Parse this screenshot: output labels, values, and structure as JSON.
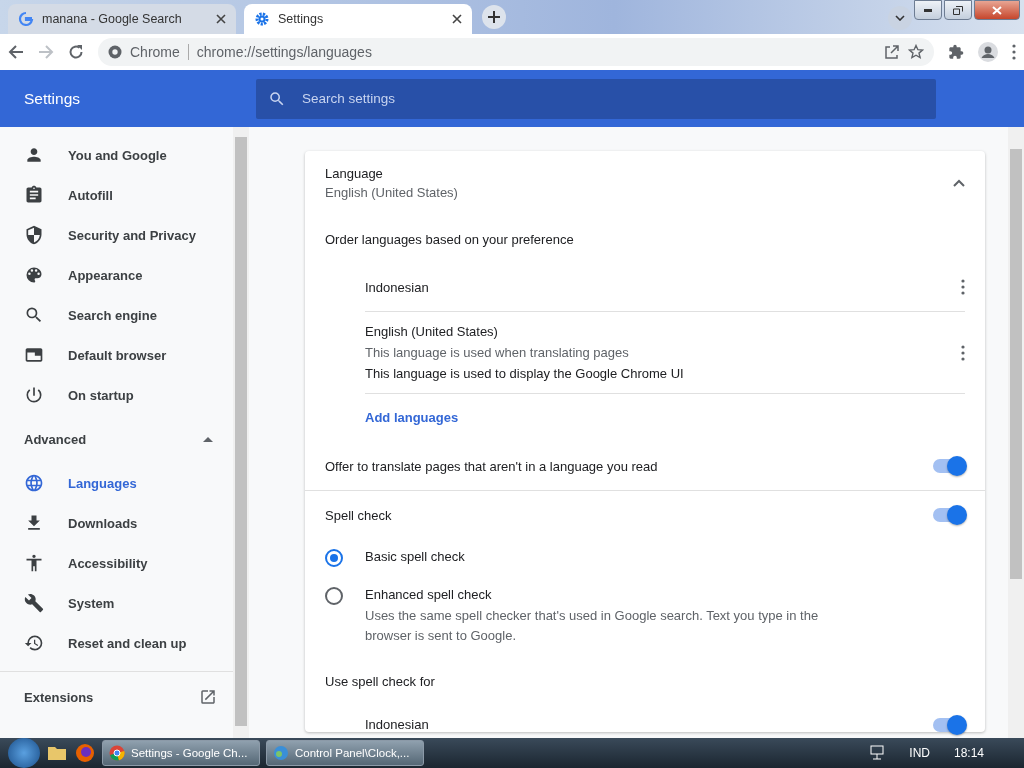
{
  "browser": {
    "tabs": [
      {
        "title": "manana - Google Search",
        "kind": "google",
        "selected": false
      },
      {
        "title": "Settings",
        "kind": "settings",
        "selected": true
      }
    ],
    "address": {
      "site": "Chrome",
      "url": "chrome://settings/languages"
    }
  },
  "header": {
    "title": "Settings",
    "search_placeholder": "Search settings"
  },
  "sidebar": {
    "items": [
      {
        "label": "You and Google",
        "kind": "person",
        "selected": false
      },
      {
        "label": "Autofill",
        "kind": "clipboard",
        "selected": false
      },
      {
        "label": "Security and Privacy",
        "kind": "shield",
        "selected": false
      },
      {
        "label": "Appearance",
        "kind": "palette",
        "selected": false
      },
      {
        "label": "Search engine",
        "kind": "search",
        "selected": false
      },
      {
        "label": "Default browser",
        "kind": "window",
        "selected": false
      },
      {
        "label": "On startup",
        "kind": "power",
        "selected": false
      }
    ],
    "advanced": {
      "label": "Advanced",
      "expanded": true,
      "items": [
        {
          "label": "Languages",
          "kind": "globe",
          "selected": true
        },
        {
          "label": "Downloads",
          "kind": "download",
          "selected": false
        },
        {
          "label": "Accessibility",
          "kind": "accessibility",
          "selected": false
        },
        {
          "label": "System",
          "kind": "wrench",
          "selected": false
        },
        {
          "label": "Reset and clean up",
          "kind": "history",
          "selected": false
        }
      ]
    },
    "extensions": "Extensions"
  },
  "language_card": {
    "language": {
      "label": "Language",
      "value": "English (United States)",
      "expanded": true
    },
    "order_heading": "Order languages based on your preference",
    "languages": [
      {
        "name": "Indonesian"
      },
      {
        "name": "English (United States)",
        "notes": [
          "This language is used when translating pages",
          "This language is used to display the Google Chrome UI"
        ]
      }
    ],
    "add_languages": "Add languages",
    "offer_translate": {
      "label": "Offer to translate pages that aren't in a language you read",
      "on": true
    }
  },
  "spell_card": {
    "spell_check": {
      "label": "Spell check",
      "on": true
    },
    "options": [
      {
        "label": "Basic spell check",
        "selected": true
      },
      {
        "label": "Enhanced spell check",
        "description": "Uses the same spell checker that's used in Google search. Text you type in the browser is sent to Google.",
        "selected": false
      }
    ],
    "use_for": "Use spell check for",
    "languages": [
      {
        "name": "Indonesian",
        "on": true
      }
    ]
  },
  "taskbar": {
    "items": [
      {
        "label": "Settings - Google Ch...",
        "kind": "chrome"
      },
      {
        "label": "Control Panel\\Clock,...",
        "kind": "control"
      }
    ],
    "language": "IND",
    "time": "18:14"
  }
}
